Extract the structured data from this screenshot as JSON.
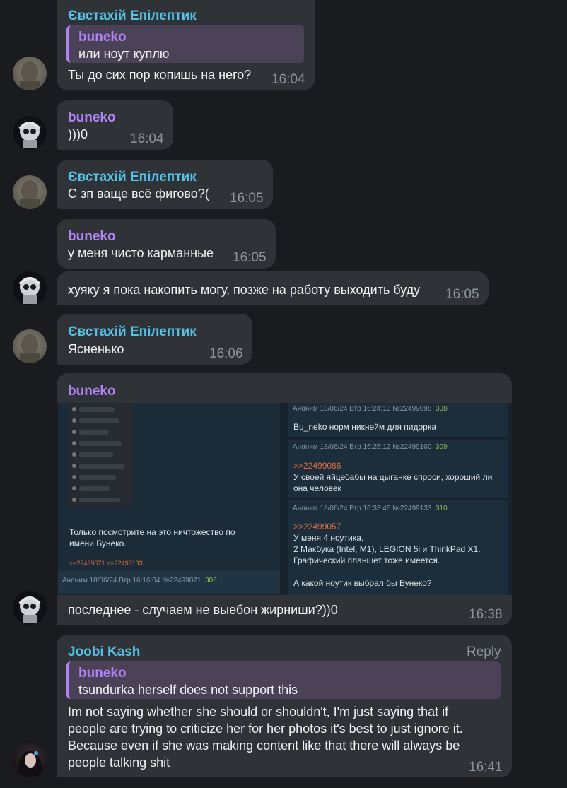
{
  "messages": {
    "m1": {
      "author": "Євстахій Епілептик",
      "reply_author": "buneko",
      "reply_text": "или ноут куплю",
      "text": "Ты до сих пор копишь на него?",
      "time": "16:04"
    },
    "m2": {
      "author": "buneko",
      "text": ")))0",
      "time": "16:04"
    },
    "m3": {
      "author": "Євстахій Епілептик",
      "text": "С зп ваще всё фигово?(",
      "time": "16:05"
    },
    "m4": {
      "author": "buneko",
      "text": "у меня чисто карманные",
      "time": "16:05"
    },
    "m5": {
      "text": "хуяку я пока накопить могу, позже на работу выходить буду",
      "time": "16:05"
    },
    "m6": {
      "author": "Євстахій Епілептик",
      "text": "Ясненько",
      "time": "16:06"
    },
    "m7": {
      "author": "buneko",
      "text": "последнее - случаем не выебон жирниши?))0",
      "time": "16:38",
      "screenshot": {
        "left_post": {
          "line1": "Только посмотрите на это ничтожество по",
          "line2": "имени Бунеко.",
          "refs": ">>22499071 >>22499133",
          "meta": "Аноним  18/06/24 Втр 16:16:04  №22499071",
          "num": "306"
        },
        "post1": {
          "meta": "Аноним  18/06/24 Втр 16:24:13  №22499098",
          "num": "308",
          "line1": "Bu_neko норм никнейм для пидорка"
        },
        "post2": {
          "meta": "Аноним  18/06/24 Втр 16:25:12  №22499100",
          "num": "309",
          "ref": ">>22499086",
          "line1": "У своей яйцебабы на цыганке спроси, хороший ли",
          "line2": "она человек"
        },
        "post3": {
          "meta": "Аноним  18/06/24 Втр 16:33:45  №22499133",
          "num": "310",
          "ref": ">>22499057",
          "line1": "У меня 4 ноутика.",
          "line2": "2 Макбука (Intel, M1), LEGION 5i и ThinkPad X1.",
          "line3": "Графический планшет тоже имеется.",
          "line4": "А какой ноутик выбрал бы Бунеко?"
        }
      }
    },
    "m8": {
      "author": "Joobi Kash",
      "reply_label": "Reply",
      "reply_author": "buneko",
      "reply_text": "tsundurka herself does not support this",
      "lines": [
        "Im not saying whether she should or shouldn't, I'm just saying that if",
        "people are trying to criticize her for her photos it's best to just ignore it.",
        "Because even if she was making content like that there will always be",
        "people talking shit"
      ],
      "time": "16:41"
    }
  },
  "colors": {
    "background": "#1a1b1f",
    "bubble": "#2f3237",
    "name_blue": "#54c3e6",
    "name_purple": "#b183f5",
    "time": "#8f949b"
  }
}
